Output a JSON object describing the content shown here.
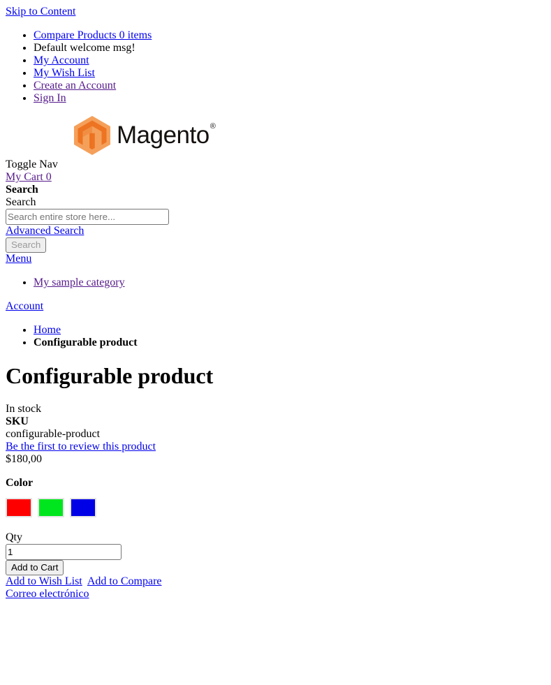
{
  "skip_link": "Skip to Content",
  "header": {
    "top_links": [
      {
        "label": "Compare Products 0 items",
        "type": "link",
        "visited": false
      },
      {
        "label": "Default welcome msg!",
        "type": "text",
        "visited": false
      },
      {
        "label": "My Account",
        "type": "link",
        "visited": false
      },
      {
        "label": "My Wish List",
        "type": "link",
        "visited": false
      },
      {
        "label": "Create an Account",
        "type": "link",
        "visited": true
      },
      {
        "label": "Sign In",
        "type": "link",
        "visited": true
      }
    ],
    "logo_text": "Magento",
    "logo_trademark": "®",
    "logo_colors": {
      "outer": "#f5a05a",
      "inner": "#ed7422",
      "word": "#14110f"
    },
    "toggle_nav": "Toggle Nav",
    "cart_link": "My Cart 0"
  },
  "search": {
    "heading": "Search",
    "label": "Search",
    "placeholder": "Search entire store here...",
    "value": "",
    "advanced_link": "Advanced Search",
    "submit_label": "Search"
  },
  "nav": {
    "menu_label": "Menu",
    "categories": [
      {
        "label": "My sample category",
        "visited": true
      }
    ],
    "account_link": "Account"
  },
  "breadcrumbs": [
    {
      "label": "Home",
      "current": false
    },
    {
      "label": "Configurable product",
      "current": true
    }
  ],
  "product": {
    "title": "Configurable product",
    "stock_status": "In stock",
    "sku_label": "SKU",
    "sku_value": "configurable-product",
    "review_link": "Be the first to review this product",
    "price": "$180,00",
    "option_label": "Color",
    "swatches": [
      {
        "name": "red",
        "color": "#ff0000"
      },
      {
        "name": "green",
        "color": "#00e61e"
      },
      {
        "name": "blue",
        "color": "#0000e6"
      }
    ],
    "qty_label": "Qty",
    "qty_value": "1",
    "add_to_cart_label": "Add to Cart",
    "wishlist_link": "Add to Wish List",
    "compare_link": "Add to Compare",
    "email_link": "Correo electrónico"
  }
}
